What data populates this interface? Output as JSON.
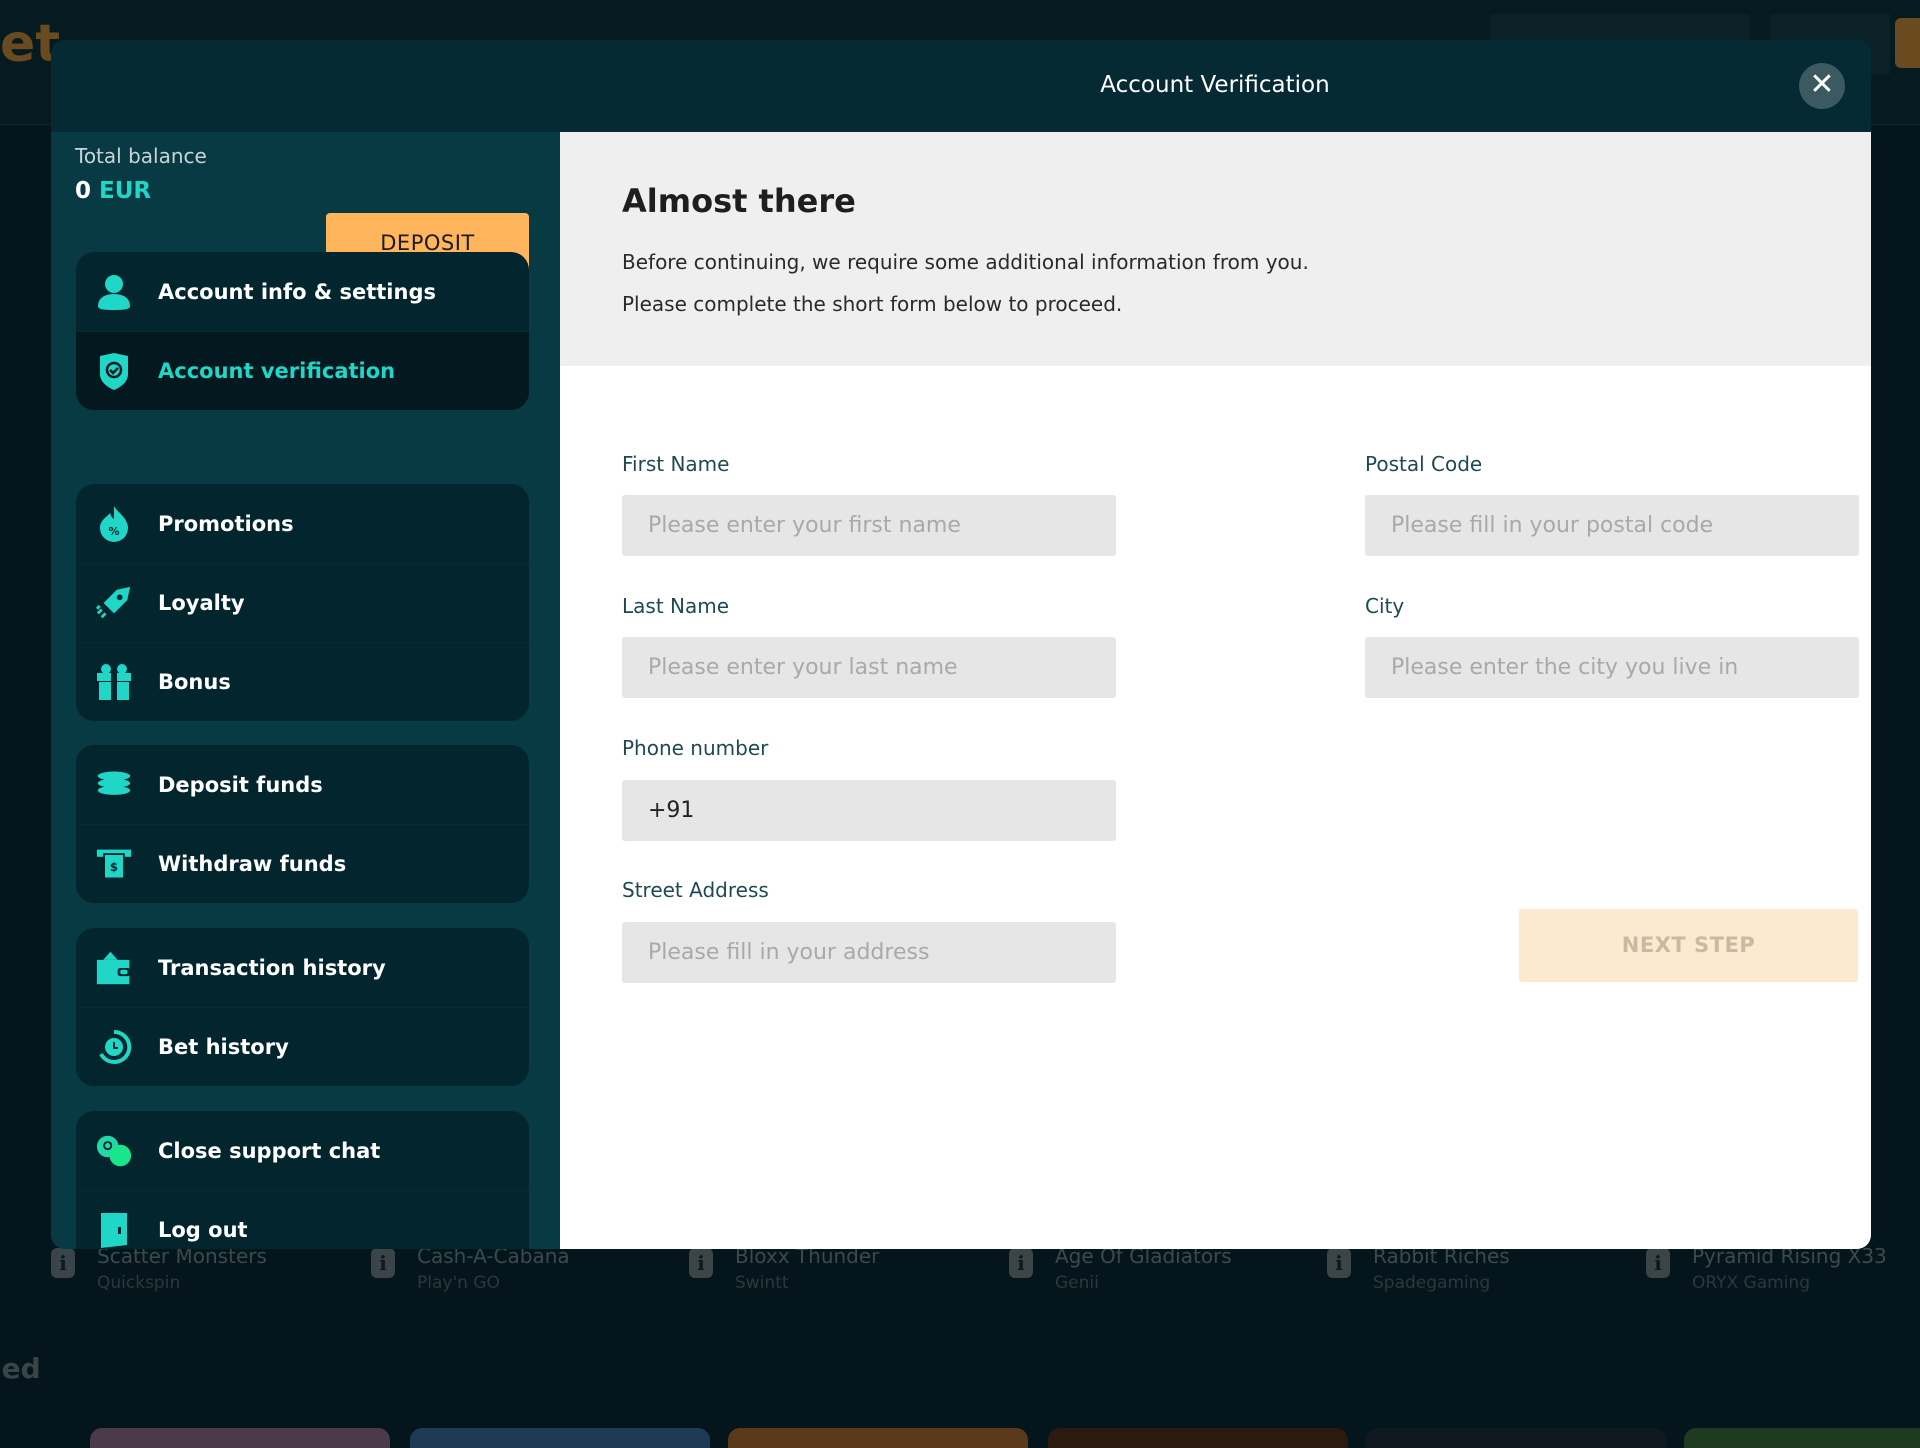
{
  "modal": {
    "title": "Account Verification",
    "close_label": "✕"
  },
  "balance": {
    "label": "Total balance",
    "amount": "0",
    "currency": "EUR",
    "deposit_label": "DEPOSIT"
  },
  "menu": [
    [
      {
        "label": "Account info & settings",
        "icon": "user-icon"
      },
      {
        "label": "Account verification",
        "icon": "shield-check-icon",
        "active": true
      }
    ],
    [
      {
        "label": "Promotions",
        "icon": "flame-percent-icon"
      },
      {
        "label": "Loyalty",
        "icon": "rocket-icon"
      },
      {
        "label": "Bonus",
        "icon": "gift-icon"
      }
    ],
    [
      {
        "label": "Deposit funds",
        "icon": "coins-stack-icon"
      },
      {
        "label": "Withdraw funds",
        "icon": "atm-cash-icon"
      }
    ],
    [
      {
        "label": "Transaction history",
        "icon": "wallet-icon"
      },
      {
        "label": "Bet history",
        "icon": "clock-history-icon"
      }
    ],
    [
      {
        "label": "Close support chat",
        "icon": "chat-bubbles-icon"
      },
      {
        "label": "Log out",
        "icon": "door-icon"
      }
    ]
  ],
  "intro": {
    "heading": "Almost there",
    "line1": "Before continuing, we require some additional information from you.",
    "line2": "Please complete the short form below to proceed."
  },
  "form": {
    "first_name": {
      "label": "First Name",
      "placeholder": "Please enter your first name",
      "value": ""
    },
    "last_name": {
      "label": "Last Name",
      "placeholder": "Please enter your last name",
      "value": ""
    },
    "phone": {
      "label": "Phone number",
      "value": "+91"
    },
    "street": {
      "label": "Street Address",
      "placeholder": "Please fill in your address",
      "value": ""
    },
    "postal": {
      "label": "Postal Code",
      "placeholder": "Please fill in your postal code",
      "value": ""
    },
    "city": {
      "label": "City",
      "placeholder": "Please enter the city you live in",
      "value": ""
    },
    "next_label": "NEXT STEP"
  },
  "background": {
    "games": [
      {
        "name": "Scatter Monsters",
        "provider": "Quickspin"
      },
      {
        "name": "Cash-A-Cabana",
        "provider": "Play'n GO"
      },
      {
        "name": "Bloxx Thunder",
        "provider": "Swintt"
      },
      {
        "name": "Age Of Gladiators",
        "provider": "Genii"
      },
      {
        "name": "Rabbit Riches",
        "provider": "Spadegaming"
      },
      {
        "name": "Pyramid Rising X33",
        "provider": "ORYX Gaming"
      }
    ],
    "info_glyph": "i",
    "section_partial": "led"
  },
  "colors": {
    "accent": "#1fd6c7",
    "deposit": "#ffb55c",
    "header": "#062a33",
    "sidebar": "#083a44"
  }
}
